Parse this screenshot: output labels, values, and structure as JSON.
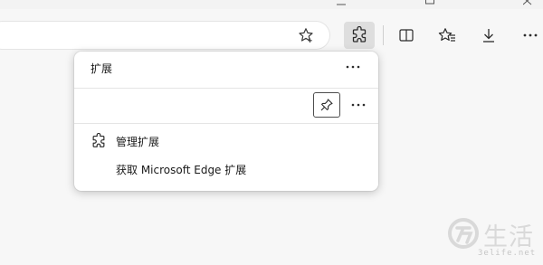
{
  "toolbar": {
    "icons": [
      "favorite-add-icon",
      "extensions-icon",
      "split-screen-icon",
      "favorites-icon",
      "downloads-icon",
      "more-icon"
    ]
  },
  "extensions_popup": {
    "title": "扩展",
    "items": [
      {
        "label": "管理扩展",
        "icon": "extensions-icon"
      },
      {
        "label": "获取 Microsoft Edge 扩展",
        "icon": ""
      }
    ]
  },
  "watermark": {
    "text": "生活",
    "url": "3elife.net"
  },
  "colors": {
    "background": "#f7f7f7",
    "popup_bg": "#ffffff",
    "active_button": "#dedede",
    "text": "#1a1a1a"
  }
}
